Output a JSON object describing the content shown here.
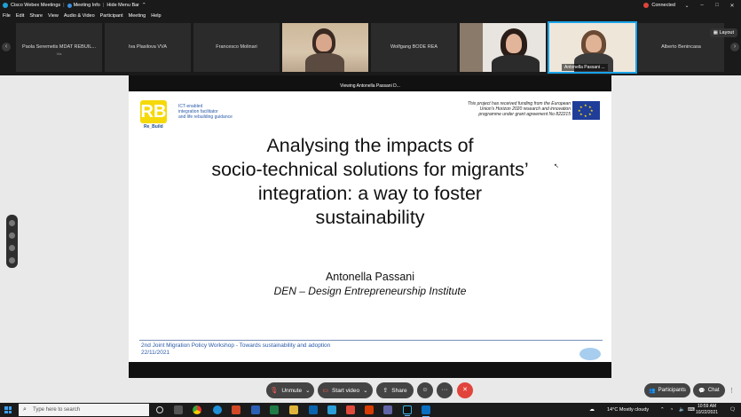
{
  "window": {
    "app_name": "Cisco Webex Meetings",
    "meeting_info": "Meeting Info",
    "hide_menu_bar": "Hide Menu Bar",
    "connection_status": "Connected",
    "minimize": "–",
    "maximize": "□",
    "close": "✕"
  },
  "menu": [
    "File",
    "Edit",
    "Share",
    "View",
    "Audio & Video",
    "Participant",
    "Meeting",
    "Help"
  ],
  "participants": [
    {
      "name": "Paola Seremetis MDAT REBUIL...",
      "sub": "Via",
      "video": false
    },
    {
      "name": "Iva Plasilova VVA",
      "sub": "",
      "video": false
    },
    {
      "name": "Francesco Molinari",
      "sub": "",
      "video": false
    },
    {
      "name": "",
      "sub": "",
      "video": true
    },
    {
      "name": "Wolfgang BODE REA",
      "sub": "",
      "video": false
    },
    {
      "name": "",
      "sub": "",
      "video": true
    },
    {
      "name": "Antonella Passani ...",
      "sub": "",
      "video": true,
      "active": true
    },
    {
      "name": "Alberto Benincasa",
      "sub": "",
      "video": false
    }
  ],
  "layout_button": "Layout",
  "strip_prev": "‹",
  "strip_next": "›",
  "viewing_banner": "Viewing Antonella Passani D...",
  "slide": {
    "logo_letters": "RB",
    "logo_caption": "Re_Build",
    "logo_text_1": "ICT-enabled",
    "logo_text_2": "integration facilitator",
    "logo_text_3": "and life rebuilding guidance",
    "funding_1": "This project has received funding from the European",
    "funding_2": "Union's Horizon 2020 research and innovation",
    "funding_3": "programme under grant agreement No 822215",
    "title_1": "Analysing the impacts of",
    "title_2": "socio-technical solutions for migrants’",
    "title_3": "integration: a way to foster",
    "title_4": "sustainability",
    "author": "Antonella Passani",
    "institute": "DEN – Design Entrepreneurship Institute",
    "workshop": "2nd Joint Migration Policy Workshop - Towards sustainability and adoption",
    "date": "22/11/2021"
  },
  "controls": {
    "unmute": "Unmute",
    "start_video": "Start video",
    "share": "Share",
    "reactions": "☺",
    "more": "···",
    "end": "✕",
    "participants": "Participants",
    "chat": "Chat"
  },
  "taskbar": {
    "search_placeholder": "Type here to search",
    "weather": "14°C  Mostly cloudy",
    "time": "10:59 AM",
    "date": "10/22/2021"
  }
}
